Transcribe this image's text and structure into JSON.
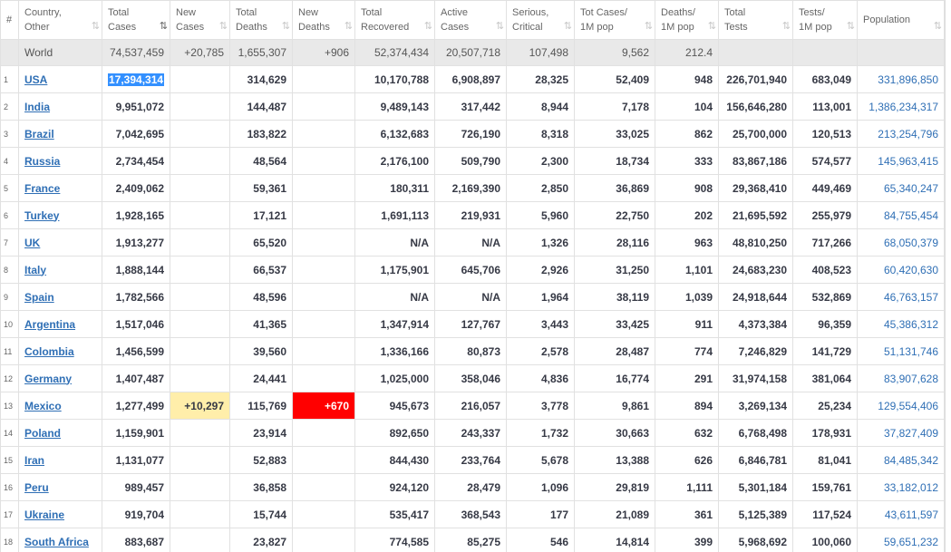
{
  "headers": [
    {
      "l1": "#",
      "l2": ""
    },
    {
      "l1": "Country,",
      "l2": "Other"
    },
    {
      "l1": "Total",
      "l2": "Cases"
    },
    {
      "l1": "New",
      "l2": "Cases"
    },
    {
      "l1": "Total",
      "l2": "Deaths"
    },
    {
      "l1": "New",
      "l2": "Deaths"
    },
    {
      "l1": "Total",
      "l2": "Recovered"
    },
    {
      "l1": "Active",
      "l2": "Cases"
    },
    {
      "l1": "Serious,",
      "l2": "Critical"
    },
    {
      "l1": "Tot Cases/",
      "l2": "1M pop"
    },
    {
      "l1": "Deaths/",
      "l2": "1M pop"
    },
    {
      "l1": "Total",
      "l2": "Tests"
    },
    {
      "l1": "Tests/",
      "l2": "1M pop"
    },
    {
      "l1": "Population",
      "l2": ""
    }
  ],
  "sort_icon": "⇅",
  "world": {
    "name": "World",
    "total_cases": "74,537,459",
    "new_cases": "+20,785",
    "total_deaths": "1,655,307",
    "new_deaths": "+906",
    "total_recovered": "52,374,434",
    "active_cases": "20,507,718",
    "serious": "107,498",
    "cases_per_1m": "9,562",
    "deaths_per_1m": "212.4",
    "total_tests": "",
    "tests_per_1m": "",
    "population": ""
  },
  "rows": [
    {
      "idx": "1",
      "country": "USA",
      "total_cases": "17,394,314",
      "new_cases": "",
      "total_deaths": "314,629",
      "new_deaths": "",
      "total_recovered": "10,170,788",
      "active_cases": "6,908,897",
      "serious": "28,325",
      "cases_per_1m": "52,409",
      "deaths_per_1m": "948",
      "total_tests": "226,701,940",
      "tests_per_1m": "683,049",
      "population": "331,896,850"
    },
    {
      "idx": "2",
      "country": "India",
      "total_cases": "9,951,072",
      "new_cases": "",
      "total_deaths": "144,487",
      "new_deaths": "",
      "total_recovered": "9,489,143",
      "active_cases": "317,442",
      "serious": "8,944",
      "cases_per_1m": "7,178",
      "deaths_per_1m": "104",
      "total_tests": "156,646,280",
      "tests_per_1m": "113,001",
      "population": "1,386,234,317"
    },
    {
      "idx": "3",
      "country": "Brazil",
      "total_cases": "7,042,695",
      "new_cases": "",
      "total_deaths": "183,822",
      "new_deaths": "",
      "total_recovered": "6,132,683",
      "active_cases": "726,190",
      "serious": "8,318",
      "cases_per_1m": "33,025",
      "deaths_per_1m": "862",
      "total_tests": "25,700,000",
      "tests_per_1m": "120,513",
      "population": "213,254,796"
    },
    {
      "idx": "4",
      "country": "Russia",
      "total_cases": "2,734,454",
      "new_cases": "",
      "total_deaths": "48,564",
      "new_deaths": "",
      "total_recovered": "2,176,100",
      "active_cases": "509,790",
      "serious": "2,300",
      "cases_per_1m": "18,734",
      "deaths_per_1m": "333",
      "total_tests": "83,867,186",
      "tests_per_1m": "574,577",
      "population": "145,963,415"
    },
    {
      "idx": "5",
      "country": "France",
      "total_cases": "2,409,062",
      "new_cases": "",
      "total_deaths": "59,361",
      "new_deaths": "",
      "total_recovered": "180,311",
      "active_cases": "2,169,390",
      "serious": "2,850",
      "cases_per_1m": "36,869",
      "deaths_per_1m": "908",
      "total_tests": "29,368,410",
      "tests_per_1m": "449,469",
      "population": "65,340,247"
    },
    {
      "idx": "6",
      "country": "Turkey",
      "total_cases": "1,928,165",
      "new_cases": "",
      "total_deaths": "17,121",
      "new_deaths": "",
      "total_recovered": "1,691,113",
      "active_cases": "219,931",
      "serious": "5,960",
      "cases_per_1m": "22,750",
      "deaths_per_1m": "202",
      "total_tests": "21,695,592",
      "tests_per_1m": "255,979",
      "population": "84,755,454"
    },
    {
      "idx": "7",
      "country": "UK",
      "total_cases": "1,913,277",
      "new_cases": "",
      "total_deaths": "65,520",
      "new_deaths": "",
      "total_recovered": "N/A",
      "active_cases": "N/A",
      "serious": "1,326",
      "cases_per_1m": "28,116",
      "deaths_per_1m": "963",
      "total_tests": "48,810,250",
      "tests_per_1m": "717,266",
      "population": "68,050,379"
    },
    {
      "idx": "8",
      "country": "Italy",
      "total_cases": "1,888,144",
      "new_cases": "",
      "total_deaths": "66,537",
      "new_deaths": "",
      "total_recovered": "1,175,901",
      "active_cases": "645,706",
      "serious": "2,926",
      "cases_per_1m": "31,250",
      "deaths_per_1m": "1,101",
      "total_tests": "24,683,230",
      "tests_per_1m": "408,523",
      "population": "60,420,630"
    },
    {
      "idx": "9",
      "country": "Spain",
      "total_cases": "1,782,566",
      "new_cases": "",
      "total_deaths": "48,596",
      "new_deaths": "",
      "total_recovered": "N/A",
      "active_cases": "N/A",
      "serious": "1,964",
      "cases_per_1m": "38,119",
      "deaths_per_1m": "1,039",
      "total_tests": "24,918,644",
      "tests_per_1m": "532,869",
      "population": "46,763,157"
    },
    {
      "idx": "10",
      "country": "Argentina",
      "total_cases": "1,517,046",
      "new_cases": "",
      "total_deaths": "41,365",
      "new_deaths": "",
      "total_recovered": "1,347,914",
      "active_cases": "127,767",
      "serious": "3,443",
      "cases_per_1m": "33,425",
      "deaths_per_1m": "911",
      "total_tests": "4,373,384",
      "tests_per_1m": "96,359",
      "population": "45,386,312"
    },
    {
      "idx": "11",
      "country": "Colombia",
      "total_cases": "1,456,599",
      "new_cases": "",
      "total_deaths": "39,560",
      "new_deaths": "",
      "total_recovered": "1,336,166",
      "active_cases": "80,873",
      "serious": "2,578",
      "cases_per_1m": "28,487",
      "deaths_per_1m": "774",
      "total_tests": "7,246,829",
      "tests_per_1m": "141,729",
      "population": "51,131,746"
    },
    {
      "idx": "12",
      "country": "Germany",
      "total_cases": "1,407,487",
      "new_cases": "",
      "total_deaths": "24,441",
      "new_deaths": "",
      "total_recovered": "1,025,000",
      "active_cases": "358,046",
      "serious": "4,836",
      "cases_per_1m": "16,774",
      "deaths_per_1m": "291",
      "total_tests": "31,974,158",
      "tests_per_1m": "381,064",
      "population": "83,907,628"
    },
    {
      "idx": "13",
      "country": "Mexico",
      "total_cases": "1,277,499",
      "new_cases": "+10,297",
      "total_deaths": "115,769",
      "new_deaths": "+670",
      "total_recovered": "945,673",
      "active_cases": "216,057",
      "serious": "3,778",
      "cases_per_1m": "9,861",
      "deaths_per_1m": "894",
      "total_tests": "3,269,134",
      "tests_per_1m": "25,234",
      "population": "129,554,406"
    },
    {
      "idx": "14",
      "country": "Poland",
      "total_cases": "1,159,901",
      "new_cases": "",
      "total_deaths": "23,914",
      "new_deaths": "",
      "total_recovered": "892,650",
      "active_cases": "243,337",
      "serious": "1,732",
      "cases_per_1m": "30,663",
      "deaths_per_1m": "632",
      "total_tests": "6,768,498",
      "tests_per_1m": "178,931",
      "population": "37,827,409"
    },
    {
      "idx": "15",
      "country": "Iran",
      "total_cases": "1,131,077",
      "new_cases": "",
      "total_deaths": "52,883",
      "new_deaths": "",
      "total_recovered": "844,430",
      "active_cases": "233,764",
      "serious": "5,678",
      "cases_per_1m": "13,388",
      "deaths_per_1m": "626",
      "total_tests": "6,846,781",
      "tests_per_1m": "81,041",
      "population": "84,485,342"
    },
    {
      "idx": "16",
      "country": "Peru",
      "total_cases": "989,457",
      "new_cases": "",
      "total_deaths": "36,858",
      "new_deaths": "",
      "total_recovered": "924,120",
      "active_cases": "28,479",
      "serious": "1,096",
      "cases_per_1m": "29,819",
      "deaths_per_1m": "1,111",
      "total_tests": "5,301,184",
      "tests_per_1m": "159,761",
      "population": "33,182,012"
    },
    {
      "idx": "17",
      "country": "Ukraine",
      "total_cases": "919,704",
      "new_cases": "",
      "total_deaths": "15,744",
      "new_deaths": "",
      "total_recovered": "535,417",
      "active_cases": "368,543",
      "serious": "177",
      "cases_per_1m": "21,089",
      "deaths_per_1m": "361",
      "total_tests": "5,125,389",
      "tests_per_1m": "117,524",
      "population": "43,611,597"
    },
    {
      "idx": "18",
      "country": "South Africa",
      "total_cases": "883,687",
      "new_cases": "",
      "total_deaths": "23,827",
      "new_deaths": "",
      "total_recovered": "774,585",
      "active_cases": "85,275",
      "serious": "546",
      "cases_per_1m": "14,814",
      "deaths_per_1m": "399",
      "total_tests": "5,968,692",
      "tests_per_1m": "100,060",
      "population": "59,651,232"
    }
  ],
  "colors": {
    "link": "#2f6fb5",
    "new_cases_bg": "#ffeeaa",
    "new_deaths_bg": "#ff0000",
    "world_bg": "#e9e9e9",
    "selection": "#3390ff"
  }
}
